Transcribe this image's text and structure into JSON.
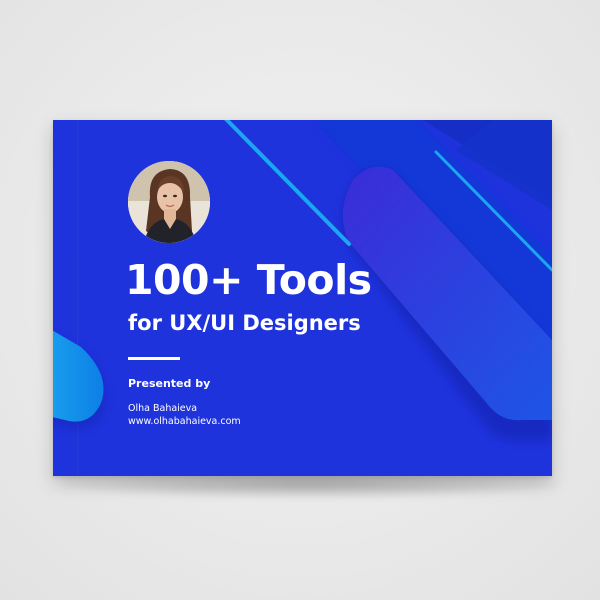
{
  "cover": {
    "title": "100+ Tools",
    "subtitle": "for UX/UI Designers",
    "presented_label": "Presented by",
    "author_name": "Olha Bahaieva",
    "author_website": "www.olhabahaieva.com"
  },
  "icons": {
    "avatar": "author-photo"
  },
  "colors": {
    "background": "#ececec",
    "cover_blue": "#1f33dd",
    "accent_light_blue": "#19a6ee",
    "accent_deep_blue": "#0a37c8",
    "text": "#ffffff"
  }
}
